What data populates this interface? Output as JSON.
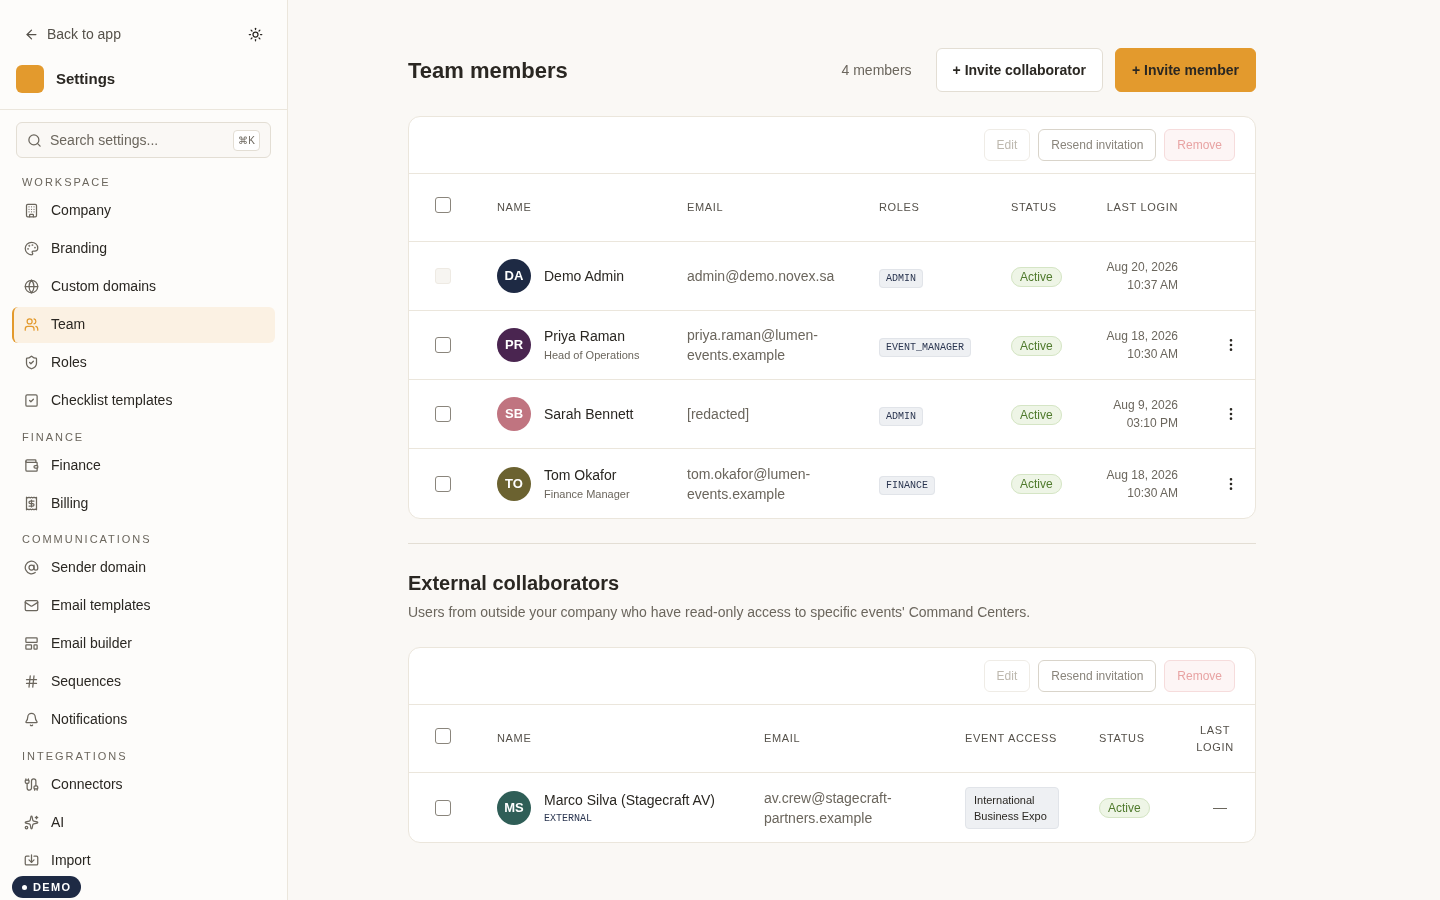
{
  "sidebar": {
    "back_link": "Back to app",
    "title": "Settings",
    "search": {
      "placeholder": "Search settings...",
      "shortcut": "⌘K"
    },
    "sections": [
      {
        "heading": "WORKSPACE",
        "items": [
          {
            "label": "Company",
            "selected": false
          },
          {
            "label": "Branding",
            "selected": false
          },
          {
            "label": "Custom domains",
            "selected": false
          },
          {
            "label": "Team",
            "selected": true
          },
          {
            "label": "Roles",
            "selected": false
          },
          {
            "label": "Checklist templates",
            "selected": false
          }
        ]
      },
      {
        "heading": "FINANCE",
        "items": [
          {
            "label": "Finance",
            "selected": false
          },
          {
            "label": "Billing",
            "selected": false
          }
        ]
      },
      {
        "heading": "COMMUNICATIONS",
        "items": [
          {
            "label": "Sender domain",
            "selected": false
          },
          {
            "label": "Email templates",
            "selected": false
          },
          {
            "label": "Email builder",
            "selected": false
          },
          {
            "label": "Sequences",
            "selected": false
          },
          {
            "label": "Notifications",
            "selected": false
          }
        ]
      },
      {
        "heading": "INTEGRATIONS",
        "items": [
          {
            "label": "Connectors",
            "selected": false
          },
          {
            "label": "AI",
            "selected": false
          },
          {
            "label": "Import",
            "selected": false
          }
        ]
      }
    ],
    "demo_badge": "DEMO"
  },
  "team": {
    "title": "Team members",
    "count": "4 members",
    "buttons": [
      {
        "label": "+ Invite collaborator",
        "kind": "secondary"
      },
      {
        "label": "+ Invite member",
        "kind": "primary"
      }
    ],
    "toolbar": [
      {
        "label": "Edit",
        "kind": "plain",
        "disabled": true
      },
      {
        "label": "Resend invitation",
        "kind": "plain",
        "disabled": false
      },
      {
        "label": "Remove",
        "kind": "danger",
        "disabled": true
      }
    ],
    "select_all": {
      "checked": false
    },
    "columns": [
      "NAME",
      "EMAIL",
      "ROLES",
      "STATUS",
      "LAST LOGIN"
    ],
    "rows": [
      {
        "checked": false,
        "disabled": true,
        "initials": "DA",
        "color": "#1e2a44",
        "name": "Demo Admin",
        "subtitle": null,
        "email": "admin@demo.novex.sa",
        "role": "ADMIN",
        "status": "Active",
        "date": "Aug 20, 2026",
        "time": "10:37 AM",
        "menu": false
      },
      {
        "checked": false,
        "disabled": false,
        "initials": "PR",
        "color": "#4a2550",
        "name": "Priya Raman",
        "subtitle": "Head of Operations",
        "email": "priya.raman@lumen-events.example",
        "role": "EVENT_MANAGER",
        "status": "Active",
        "date": "Aug 18, 2026",
        "time": "10:30 AM",
        "menu": true
      },
      {
        "checked": false,
        "disabled": false,
        "initials": "SB",
        "color": "#c07480",
        "name": "Sarah Bennett",
        "subtitle": null,
        "email": "[redacted]",
        "role": "ADMIN",
        "status": "Active",
        "date": "Aug 9, 2026",
        "time": "03:10 PM",
        "menu": true
      },
      {
        "checked": false,
        "disabled": false,
        "initials": "TO",
        "color": "#6b6230",
        "name": "Tom Okafor",
        "subtitle": "Finance Manager",
        "email": "tom.okafor@lumen-events.example",
        "role": "FINANCE",
        "status": "Active",
        "date": "Aug 18, 2026",
        "time": "10:30 AM",
        "menu": true
      }
    ]
  },
  "external": {
    "title": "External collaborators",
    "description": "Users from outside your company who have read-only access to specific events' Command Centers.",
    "toolbar": [
      {
        "label": "Edit",
        "kind": "plain",
        "disabled": true
      },
      {
        "label": "Resend invitation",
        "kind": "plain",
        "disabled": false
      },
      {
        "label": "Remove",
        "kind": "danger",
        "disabled": true
      }
    ],
    "select_all": {
      "checked": false
    },
    "columns": [
      "NAME",
      "EMAIL",
      "EVENT ACCESS",
      "STATUS",
      "LAST LOGIN"
    ],
    "rows": [
      {
        "checked": false,
        "initials": "MS",
        "color": "#2f5e57",
        "name": "Marco Silva (Stagecraft AV)",
        "tag": "EXTERNAL",
        "email": "av.crew@stagecraft-partners.example",
        "event": "International Business Expo",
        "status": "Active",
        "last_login": "—"
      }
    ]
  }
}
